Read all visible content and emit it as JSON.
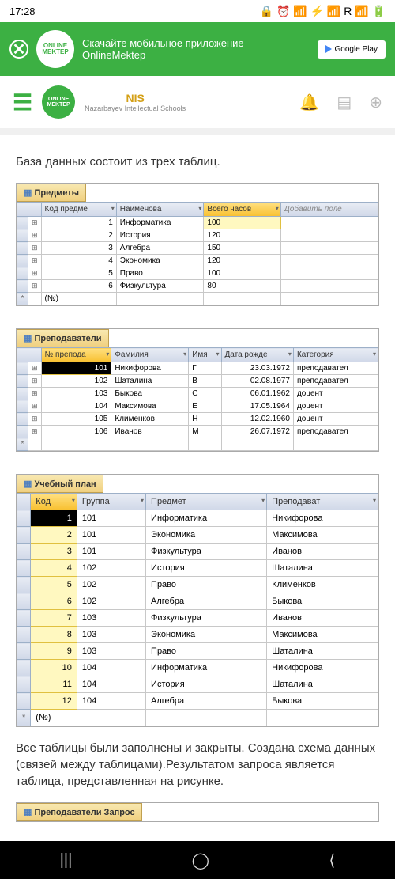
{
  "status": {
    "time": "17:28",
    "icons": "🖼",
    "right": "🔒 ⏰ 📶 ⚡ 📶 R 📶 🔋"
  },
  "banner": {
    "logo": "ONLINE MEKTEP",
    "text": "Скачайте мобильное приложение OnlineMektep",
    "btn": "Google Play"
  },
  "header": {
    "logo": "ONLINE MEKTEP",
    "nis": "NIS",
    "nis_sub": "Nazarbayev Intellectual Schools"
  },
  "intro": "База данных состоит из трех таблиц.",
  "t1": {
    "name": "Предметы",
    "cols": [
      "Код предме",
      "Наименова",
      "Всего часов",
      "Добавить поле"
    ],
    "rows": [
      [
        "1",
        "Информатика",
        "100"
      ],
      [
        "2",
        "История",
        "120"
      ],
      [
        "3",
        "Алгебра",
        "150"
      ],
      [
        "4",
        "Экономика",
        "120"
      ],
      [
        "5",
        "Право",
        "100"
      ],
      [
        "6",
        "Физкультура",
        "80"
      ]
    ],
    "footer": "(№)"
  },
  "t2": {
    "name": "Преподаватели",
    "cols": [
      "№ препода",
      "Фамилия",
      "Имя",
      "Дата рожде",
      "Категория"
    ],
    "rows": [
      [
        "101",
        "Никифорова",
        "Г",
        "23.03.1972",
        "преподавател"
      ],
      [
        "102",
        "Шаталина",
        "В",
        "02.08.1977",
        "преподавател"
      ],
      [
        "103",
        "Быкова",
        "С",
        "06.01.1962",
        "доцент"
      ],
      [
        "104",
        "Максимова",
        "Е",
        "17.05.1964",
        "доцент"
      ],
      [
        "105",
        "Клименков",
        "Н",
        "12.02.1960",
        "доцент"
      ],
      [
        "106",
        "Иванов",
        "М",
        "26.07.1972",
        "преподавател"
      ]
    ]
  },
  "t3": {
    "name": "Учебный план",
    "cols": [
      "Код",
      "Группа",
      "Предмет",
      "Преподават"
    ],
    "rows": [
      [
        "1",
        "101",
        "Информатика",
        "Никифорова"
      ],
      [
        "2",
        "101",
        "Экономика",
        "Максимова"
      ],
      [
        "3",
        "101",
        "Физкультура",
        "Иванов"
      ],
      [
        "4",
        "102",
        "История",
        "Шаталина"
      ],
      [
        "5",
        "102",
        "Право",
        "Клименков"
      ],
      [
        "6",
        "102",
        "Алгебра",
        "Быкова"
      ],
      [
        "7",
        "103",
        "Физкультура",
        "Иванов"
      ],
      [
        "8",
        "103",
        "Экономика",
        "Максимова"
      ],
      [
        "9",
        "103",
        "Право",
        "Шаталина"
      ],
      [
        "10",
        "104",
        "Информатика",
        "Никифорова"
      ],
      [
        "11",
        "104",
        "История",
        "Шаталина"
      ],
      [
        "12",
        "104",
        "Алгебра",
        "Быкова"
      ]
    ],
    "footer": "(№)"
  },
  "outro": "Все таблицы были заполнены и закрыты. Создана схема данных (связей между таблицами).Результатом запроса является таблица, представленная на рисунке.",
  "t4": {
    "name": "Преподаватели Запрос"
  }
}
